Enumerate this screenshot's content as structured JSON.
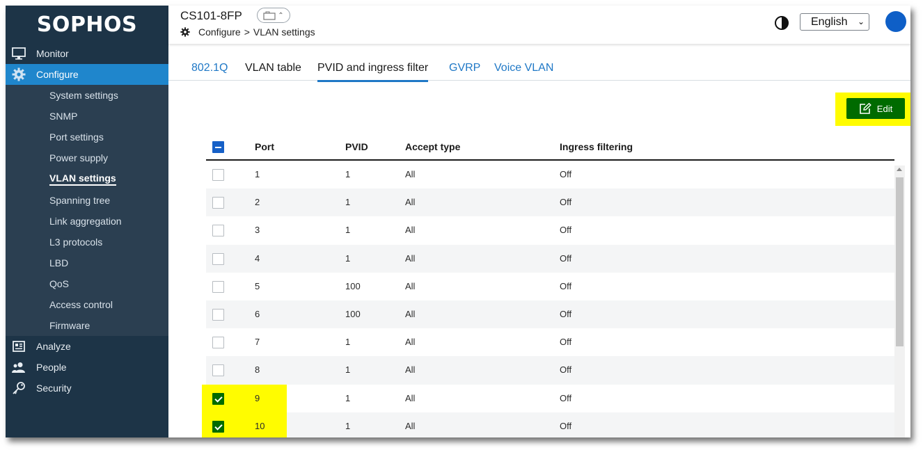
{
  "app": {
    "logo": "SOPHOS"
  },
  "header": {
    "device_name": "CS101-8FP",
    "breadcrumb": {
      "section": "Configure",
      "separator": ">",
      "page": "VLAN settings"
    },
    "language": "English"
  },
  "sidebar": {
    "top_items": [
      {
        "label": "Monitor",
        "icon": "monitor-icon"
      },
      {
        "label": "Configure",
        "icon": "gear-icon",
        "active": true
      }
    ],
    "configure_items": [
      "System settings",
      "SNMP",
      "Port settings",
      "Power supply",
      "VLAN settings",
      "Spanning tree",
      "Link aggregation",
      "L3 protocols",
      "LBD",
      "QoS",
      "Access control",
      "Firmware"
    ],
    "current_item": "VLAN settings",
    "bottom_items": [
      {
        "label": "Analyze",
        "icon": "analyze-icon"
      },
      {
        "label": "People",
        "icon": "people-icon"
      },
      {
        "label": "Security",
        "icon": "key-icon"
      }
    ]
  },
  "tabs": [
    {
      "label": "802.1Q"
    },
    {
      "label": "VLAN table"
    },
    {
      "label": "PVID and ingress filter",
      "active": true
    },
    {
      "label": "GVRP"
    },
    {
      "label": "Voice VLAN"
    }
  ],
  "toolbar": {
    "edit_label": "Edit"
  },
  "table": {
    "columns": [
      "Port",
      "PVID",
      "Accept type",
      "Ingress filtering"
    ],
    "rows": [
      {
        "port": "1",
        "pvid": "1",
        "accept": "All",
        "ingress": "Off",
        "checked": false
      },
      {
        "port": "2",
        "pvid": "1",
        "accept": "All",
        "ingress": "Off",
        "checked": false
      },
      {
        "port": "3",
        "pvid": "1",
        "accept": "All",
        "ingress": "Off",
        "checked": false
      },
      {
        "port": "4",
        "pvid": "1",
        "accept": "All",
        "ingress": "Off",
        "checked": false
      },
      {
        "port": "5",
        "pvid": "100",
        "accept": "All",
        "ingress": "Off",
        "checked": false
      },
      {
        "port": "6",
        "pvid": "100",
        "accept": "All",
        "ingress": "Off",
        "checked": false
      },
      {
        "port": "7",
        "pvid": "1",
        "accept": "All",
        "ingress": "Off",
        "checked": false
      },
      {
        "port": "8",
        "pvid": "1",
        "accept": "All",
        "ingress": "Off",
        "checked": false
      },
      {
        "port": "9",
        "pvid": "1",
        "accept": "All",
        "ingress": "Off",
        "checked": true
      },
      {
        "port": "10",
        "pvid": "1",
        "accept": "All",
        "ingress": "Off",
        "checked": true
      }
    ]
  },
  "colors": {
    "sidebar_bg": "#1d3447",
    "active_nav": "#1f86cc",
    "link_blue": "#1f78c6",
    "edit_green": "#006b00",
    "highlight": "#fffc00"
  }
}
